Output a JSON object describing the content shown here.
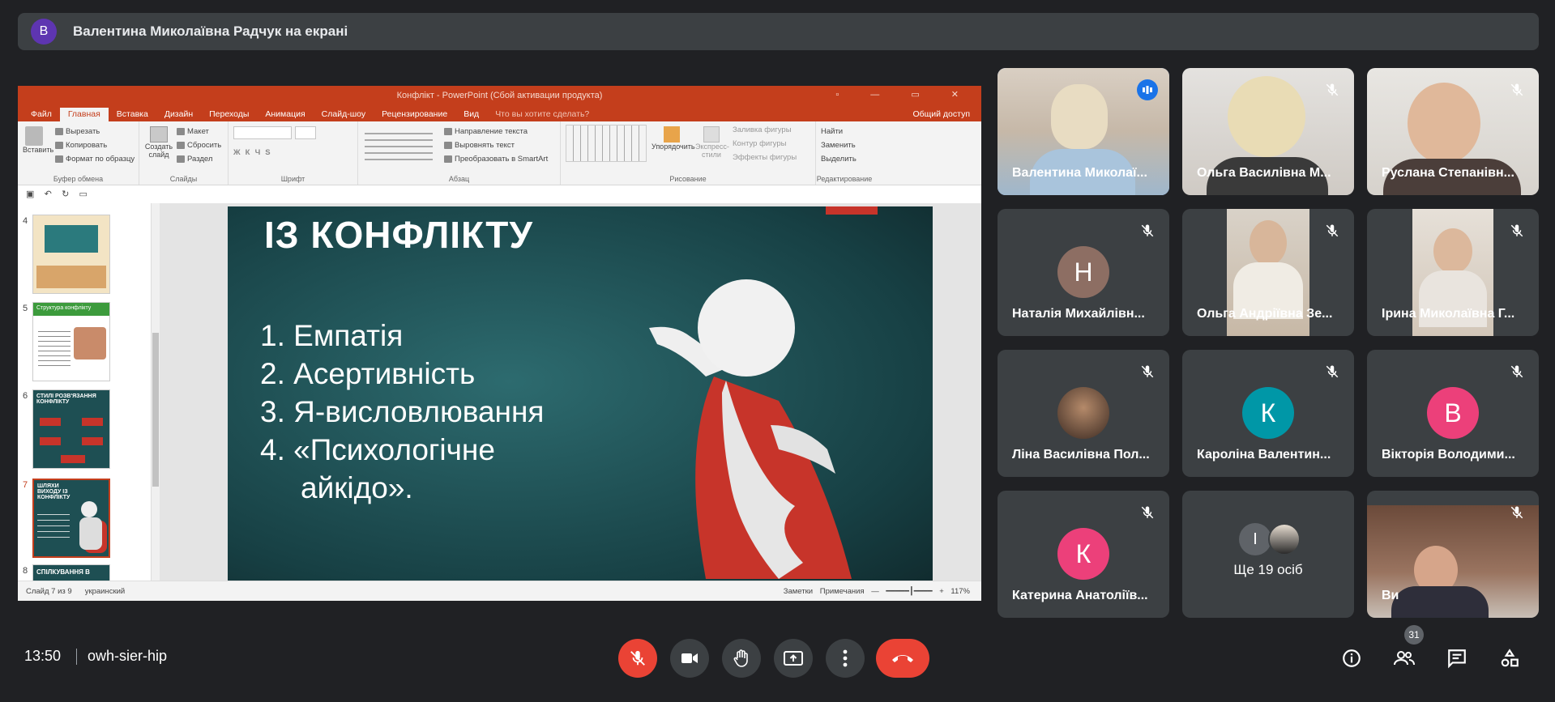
{
  "presenter_bar": {
    "avatar_letter": "В",
    "text": "Валентина Миколаївна Радчук на екрані"
  },
  "ppt": {
    "title": "Конфлікт - PowerPoint (Сбой активации продукта)",
    "tabs": [
      "Файл",
      "Главная",
      "Вставка",
      "Дизайн",
      "Переходы",
      "Анимация",
      "Слайд-шоу",
      "Рецензирование",
      "Вид",
      "Что вы хотите сделать?"
    ],
    "share_label": "Общий доступ",
    "groups": {
      "clipboard": {
        "caption": "Буфер обмена",
        "paste": "Вставить",
        "cut": "Вырезать",
        "copy": "Копировать",
        "format": "Формат по образцу"
      },
      "slides": {
        "caption": "Слайды",
        "new": "Создать слайд",
        "layout": "Макет",
        "reset": "Сбросить",
        "section": "Раздел"
      },
      "font": {
        "caption": "Шрифт"
      },
      "paragraph": {
        "caption": "Абзац",
        "dir": "Направление текста",
        "align": "Выровнять текст",
        "smartart": "Преобразовать в SmartArt"
      },
      "drawing": {
        "caption": "Рисование",
        "arrange": "Упорядочить",
        "styles": "Экспресс-стили",
        "fill": "Заливка фигуры",
        "outline": "Контур фигуры",
        "effects": "Эффекты фигуры"
      },
      "editing": {
        "caption": "Редактирование",
        "find": "Найти",
        "replace": "Заменить",
        "select": "Выделить"
      }
    },
    "thumbs": [
      {
        "num": "4",
        "title": ""
      },
      {
        "num": "5",
        "title": "Структура конфлікту"
      },
      {
        "num": "6",
        "title": "СТИЛІ РОЗВ'ЯЗАННЯ КОНФЛІКТУ"
      },
      {
        "num": "7",
        "title": "ШЛЯХИ ВИХОДУ ІЗ КОНФЛІКТУ"
      },
      {
        "num": "8",
        "title": "СПІЛКУВАННЯ В"
      }
    ],
    "slide": {
      "title": "ІЗ КОНФЛІКТУ",
      "items": [
        "1. Емпатія",
        "2. Асертивність",
        "3. Я-висловлювання",
        "4. «Психологічне",
        "айкідо»."
      ]
    },
    "status": {
      "slide": "Слайд 7 из 9",
      "lang": "украинский",
      "notes": "Заметки",
      "comments": "Примечания",
      "zoom": "117%"
    }
  },
  "tiles": [
    {
      "name": "Валентина Миколаї...",
      "speaking": true
    },
    {
      "name": "Ольга Василівна М..."
    },
    {
      "name": "Руслана Степанівн..."
    },
    {
      "name": "Наталія Михайлівн...",
      "letter": "Н",
      "color": "#8d6e63"
    },
    {
      "name": "Ольга Андріївна Зе..."
    },
    {
      "name": "Ірина Миколаївна Г..."
    },
    {
      "name": "Ліна Василівна Пол..."
    },
    {
      "name": "Кароліна Валентин...",
      "letter": "К",
      "color": "#0097a7"
    },
    {
      "name": "Вікторія Володими...",
      "letter": "В",
      "color": "#ec407a"
    },
    {
      "name": "Катерина Анатоліїв...",
      "letter": "К",
      "color": "#ec407a"
    },
    {
      "name": "Ще 19 осіб",
      "letter": "І"
    },
    {
      "name": "Ви"
    }
  ],
  "bottom": {
    "time": "13:50",
    "meeting_code": "owh-sier-hip",
    "participants_count": "31"
  }
}
